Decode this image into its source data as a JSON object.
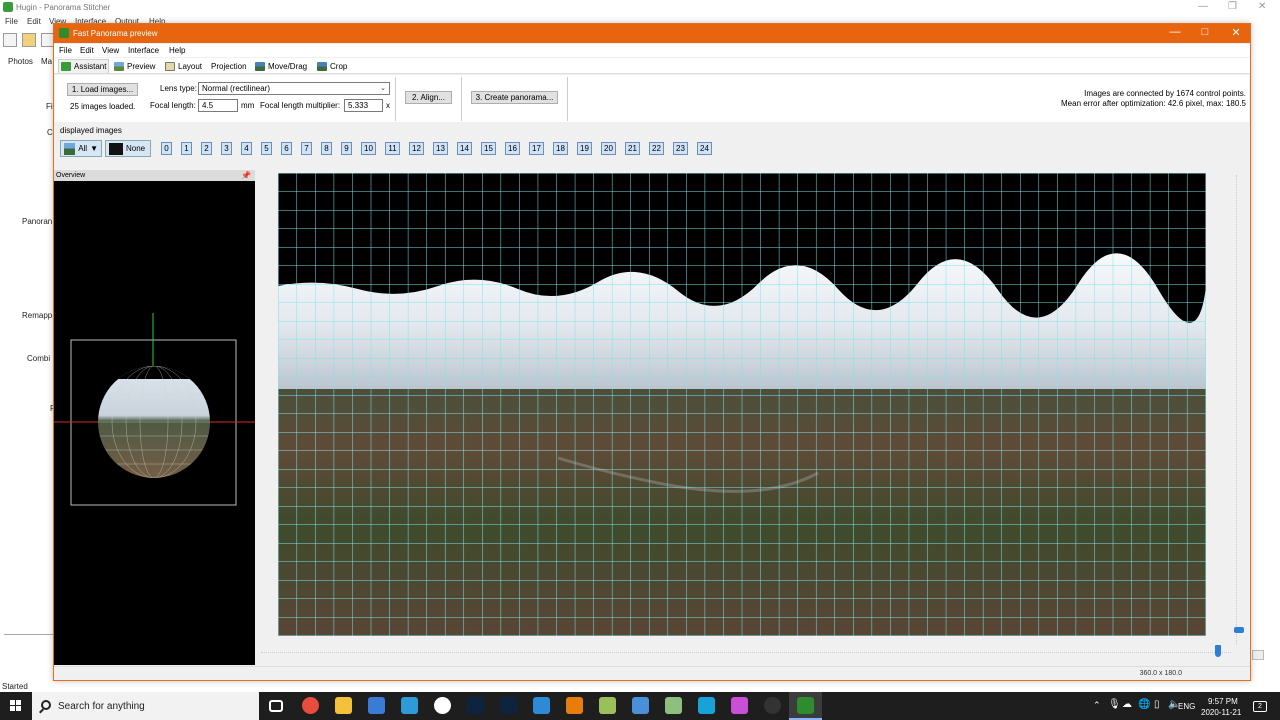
{
  "bg_window": {
    "title": "Hugin - Panorama Stitcher",
    "menu": [
      "File",
      "Edit",
      "View",
      "Interface",
      "Output",
      "Help"
    ],
    "tabs": [
      "Photos",
      "Ma"
    ],
    "side_labels": [
      "Fi",
      "C",
      "Panoran",
      "Remapp",
      "Combi",
      "F"
    ],
    "status": "Started"
  },
  "window": {
    "title": "Fast Panorama preview",
    "menu": [
      "File",
      "Edit",
      "View",
      "Interface",
      "Help"
    ],
    "tabs": [
      {
        "label": "Assistant",
        "icon": "assistant-icon"
      },
      {
        "label": "Preview",
        "icon": "preview-icon"
      },
      {
        "label": "Layout",
        "icon": "layout-icon"
      },
      {
        "label": "Projection",
        "icon": "projection-icon"
      },
      {
        "label": "Move/Drag",
        "icon": "move-drag-icon"
      },
      {
        "label": "Crop",
        "icon": "crop-icon"
      }
    ],
    "active_tab": "Assistant"
  },
  "assistant": {
    "load_button": "1. Load images...",
    "images_loaded": "25 images loaded.",
    "lens_type_label": "Lens type:",
    "lens_type_value": "Normal (rectilinear)",
    "focal_length_label": "Focal length:",
    "focal_length_value": "4.5",
    "focal_length_unit": "mm",
    "multiplier_label": "Focal length multiplier:",
    "multiplier_value": "5.333",
    "multiplier_unit": "x",
    "align_button": "2. Align...",
    "create_button": "3. Create panorama...",
    "info_line1": "Images are connected by 1674 control points.",
    "info_line2": "Mean error after optimization: 42.6 pixel, max: 180.5"
  },
  "displayed_images": {
    "label": "displayed images",
    "all_label": "All",
    "none_label": "None",
    "numbers": [
      "0",
      "1",
      "2",
      "3",
      "4",
      "5",
      "6",
      "7",
      "8",
      "9",
      "10",
      "11",
      "12",
      "13",
      "14",
      "15",
      "16",
      "17",
      "18",
      "19",
      "20",
      "21",
      "22",
      "23",
      "24"
    ]
  },
  "overview": {
    "title": "Overview",
    "pin": "↑"
  },
  "status": {
    "fov": "360.0 x 180.0"
  },
  "taskbar": {
    "search_placeholder": "Search for anything",
    "language": "ENG",
    "time": "9:57 PM",
    "date": "2020-11-21",
    "notifications": "2",
    "apps": [
      {
        "name": "task-view-icon",
        "color": "#1e1e1e"
      },
      {
        "name": "chrome-icon",
        "color": "#e74c3c"
      },
      {
        "name": "file-explorer-icon",
        "color": "#f3c13a"
      },
      {
        "name": "app-blue-icon",
        "color": "#3a7bd5"
      },
      {
        "name": "store-icon",
        "color": "#2e9bd6"
      },
      {
        "name": "app-red-circle-icon",
        "color": "#ffffff"
      },
      {
        "name": "lightroom-icon",
        "color": "#0d2340"
      },
      {
        "name": "photoshop-icon",
        "color": "#0d2340"
      },
      {
        "name": "vscode-icon",
        "color": "#2c8ad6"
      },
      {
        "name": "blender-icon",
        "color": "#e87d0d"
      },
      {
        "name": "app-green-icon",
        "color": "#9bbf5a"
      },
      {
        "name": "app-diamond-icon",
        "color": "#4a90d9"
      },
      {
        "name": "app-check-icon",
        "color": "#8fbf7f"
      },
      {
        "name": "app-wikipedia-icon",
        "color": "#17a2d8"
      },
      {
        "name": "app-triangle-icon",
        "color": "#c94fd6"
      },
      {
        "name": "obs-icon",
        "color": "#333333"
      },
      {
        "name": "hugin-icon",
        "color": "#2e8b2e"
      }
    ]
  }
}
